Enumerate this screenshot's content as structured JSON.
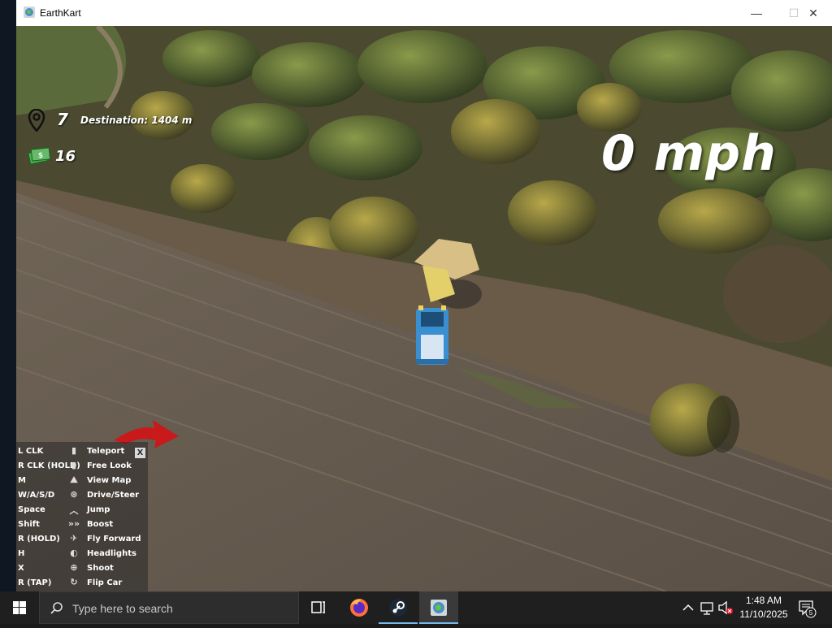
{
  "window": {
    "title": "EarthKart",
    "minimize_glyph": "—",
    "maximize_glyph": "☐",
    "close_glyph": "✕"
  },
  "hud": {
    "checkpoint_count": "7",
    "destination_label": "Destination: 1404 m",
    "cash_count": "16",
    "speed": "0 mph",
    "icons": {
      "checkpoint": "map-pin-icon",
      "cash": "cash-icon"
    }
  },
  "controls": {
    "close_label": "X",
    "rows": [
      {
        "key": "L CLK",
        "icon": "mouse-left-icon",
        "action": "Teleport"
      },
      {
        "key": "R CLK (HOLD)",
        "icon": "mouse-right-icon",
        "action": "Free Look"
      },
      {
        "key": "M",
        "icon": "map-icon",
        "action": "View Map"
      },
      {
        "key": "W/A/S/D",
        "icon": "steering-wheel-icon",
        "action": "Drive/Steer"
      },
      {
        "key": "Space",
        "icon": "jump-icon",
        "action": "Jump"
      },
      {
        "key": "Shift",
        "icon": "boost-icon",
        "action": "Boost"
      },
      {
        "key": "R (HOLD)",
        "icon": "fly-icon",
        "action": "Fly Forward"
      },
      {
        "key": "H",
        "icon": "headlights-icon",
        "action": "Headlights"
      },
      {
        "key": "X",
        "icon": "shoot-icon",
        "action": "Shoot"
      },
      {
        "key": "R (TAP)",
        "icon": "flip-icon",
        "action": "Flip Car"
      }
    ]
  },
  "taskbar": {
    "search_placeholder": "Type here to search",
    "apps": [
      "task-view-icon",
      "firefox-icon",
      "steam-icon",
      "earthkart-icon"
    ],
    "clock_time": "1:48 AM",
    "clock_date": "11/10/2025",
    "notification_count": "5"
  },
  "colors": {
    "taskbar_bg": "#1f1f1f",
    "accent": "#76b9ed",
    "hud_text": "#ffffff",
    "car_blue": "#3a8fd0"
  }
}
